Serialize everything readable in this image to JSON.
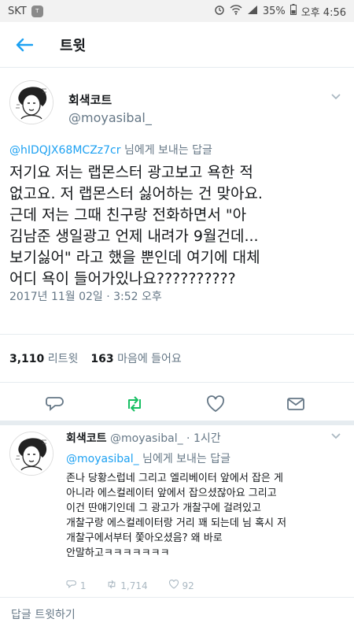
{
  "status_bar": {
    "carrier": "SKT",
    "carrier_badge": "T",
    "battery": "35%",
    "time": "오후 4:56"
  },
  "header": {
    "back_icon": "arrow-left-icon",
    "title": "트윗"
  },
  "tweet": {
    "display_name": "회색코트",
    "username": "@moyasibal_",
    "reply_mention": "@hIDQJX68MCZz7cr",
    "reply_suffix": " 님에게 보내는 답글",
    "text_lines": [
      "저기요 저는 랩몬스터 광고보고 욕한 적",
      "없고요. 저 랩몬스터 싫어하는 건 맞아요.",
      "근데 저는 그때 친구랑 전화하면서 \"아",
      "김남준 생일광고 언제 내려가 9월건데...",
      "보기싫어\" 라고 했을 뿐인데 여기에 대체",
      "어디 욕이 들어가있나요??????????"
    ],
    "timestamp": "2017년 11월 02일 · 3:52 오후",
    "retweet_count": "3,110",
    "retweet_label": "리트윗",
    "like_count": "163",
    "like_label": "마음에 들어요",
    "accent_color": "#1da1f2",
    "retweet_color": "#17bf63"
  },
  "reply": {
    "display_name": "회색코트",
    "username": "@moyasibal_",
    "time": "· 1시간",
    "reply_mention": "@moyasibal_",
    "reply_suffix": " 님에게 보내는 답글",
    "text_lines": [
      "존나 당황스럽네 그리고 엘리베이터 앞에서 잡은 게",
      "아니라 에스컬레이터 앞에서 잡으셨잖아요 그리고",
      "이건 딴얘기인데 그 광고가 개찰구에 걸려있고",
      "개찰구랑 에스컬레이터랑 거리 꽤 되는데 님 혹시 저",
      "개찰구에서부터 쫓아오셨음? 왜 바로",
      "안말하고ㅋㅋㅋㅋㅋㅋㅋ"
    ],
    "reply_count": "1",
    "retweet_count": "1,714",
    "like_count": "92"
  },
  "compose": {
    "placeholder": "답글 트윗하기"
  }
}
